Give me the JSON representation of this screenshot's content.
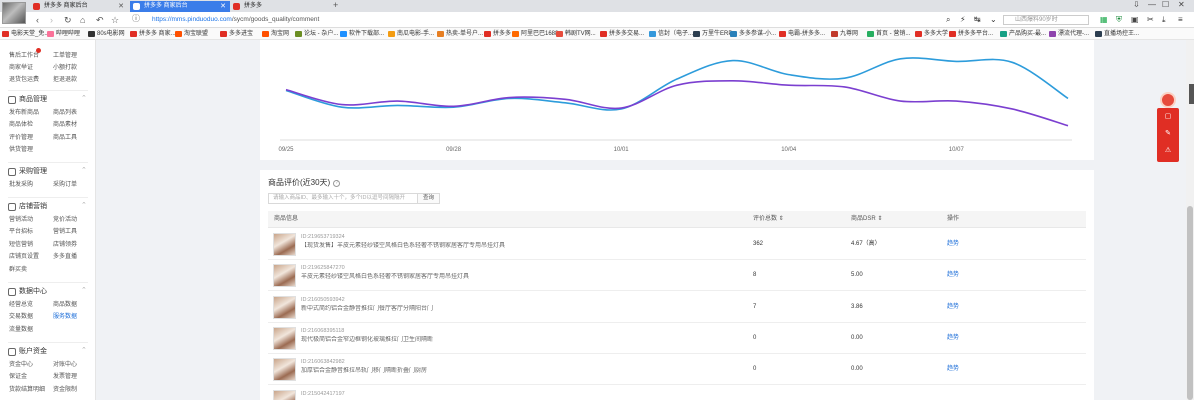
{
  "browser": {
    "tabs": [
      {
        "label": "拼多多 商家后台",
        "active": false
      },
      {
        "label": "拼多多 商家后台",
        "active": true
      },
      {
        "label": "拼多多",
        "active": false
      }
    ],
    "new_tab": "+",
    "url_host": "https://mms.pinduoduo.com",
    "url_path": "/sycm/goods_quality/comment",
    "search_placeholder": "山西爆料90岁时",
    "window_controls": [
      "⇩",
      "—",
      "☐",
      "✕"
    ]
  },
  "bookmarks": [
    "电影天堂_免...",
    "哔哩哔哩",
    "80s电影网",
    "拼多多 商家...",
    "淘宝联盟",
    "多多进宝",
    "淘宝网",
    "论坛 - 杂户...",
    "软件下载部...",
    "南瓜电影-手...",
    "热卖-单号户...",
    "拼多多",
    "阿里巴巴1688...",
    "韩剧TV网...",
    "拼多多交易...",
    "信封（电子...",
    "万里牛ERP",
    "多多参谋-小...",
    "电霸-拼多多...",
    "九尊网",
    "首页 - 营销...",
    "多多大学",
    "拼多多平台...",
    "产品购买-最...",
    "漂流代理-...",
    "直播场控王..."
  ],
  "sidebar": {
    "top_items": [
      {
        "label": "售后工作台",
        "col": 0
      },
      {
        "label": "工单管理",
        "col": 1
      },
      {
        "label": "商家举证",
        "col": 0
      },
      {
        "label": "小额打款",
        "col": 1
      },
      {
        "label": "退货包运费",
        "col": 0
      },
      {
        "label": "拒退退款",
        "col": 1
      }
    ],
    "sections": [
      {
        "title": "商品管理",
        "items": [
          "发布新商品",
          "商品列表",
          "商品体检",
          "商品素材",
          "评价管理",
          "商品工具",
          "供货管理"
        ]
      },
      {
        "title": "采购管理",
        "items": [
          "批发采购",
          "采购订单"
        ]
      },
      {
        "title": "店铺营销",
        "items": [
          "营销活动",
          "竞价活动",
          "平台招标",
          "营销工具",
          "短信营销",
          "店铺领券",
          "店铺页设置",
          "多多直播",
          "群买卖"
        ]
      },
      {
        "title": "数据中心",
        "items": [
          "经营总览",
          "商品数据",
          "交易数据",
          "服务数据",
          "流量数据"
        ]
      },
      {
        "title": "账户资金",
        "items": [
          "资金中心",
          "对账中心",
          "保证金",
          "发票管理",
          "货款结算明细",
          "资金限制"
        ]
      }
    ]
  },
  "chart_data": {
    "type": "line",
    "x": [
      "09/25",
      "09/26",
      "09/27",
      "09/28",
      "09/29",
      "09/30",
      "10/01",
      "10/02",
      "10/03",
      "10/04",
      "10/05",
      "10/06",
      "10/07",
      "10/08",
      "10/09"
    ],
    "tick_labels": [
      "09/25",
      "09/28",
      "10/01",
      "10/04",
      "10/07"
    ],
    "series": [
      {
        "color": "#2d9cdb",
        "values": [
          54,
          35,
          37,
          35,
          45,
          40,
          33,
          67,
          88,
          72,
          68,
          90,
          87,
          86,
          45
        ]
      },
      {
        "color": "#7b3fd0",
        "values": [
          55,
          38,
          42,
          36,
          46,
          44,
          34,
          60,
          65,
          60,
          58,
          42,
          42,
          33,
          14
        ]
      }
    ],
    "ylim": [
      0,
      100
    ],
    "grid": false,
    "legend": "none"
  },
  "reviews": {
    "title": "商品评价(近30天)",
    "help_icon": "?",
    "search_placeholder": "请输入商品ID、最多输入十个，多个ID以逗号间隔隔开",
    "search_button": "查询",
    "columns": [
      "商品信息",
      "评价总数 ⇕",
      "商品DSR ⇕",
      "操作"
    ],
    "rows": [
      {
        "id": "ID:219653719324",
        "name": "【现货发售】羊皮元素轻纱镂空风格白色系轻奢不锈钢家居客厅专用吊挂灯具",
        "count": "362",
        "dsr": "4.67（高）",
        "action": "趋势"
      },
      {
        "id": "ID:219625847270",
        "name": "羊皮元素轻纱镂空风格白色系轻奢不锈钢家居客厅专用吊挂灯具",
        "count": "8",
        "dsr": "5.00",
        "action": "趋势"
      },
      {
        "id": "ID:216050593942",
        "name": "新中式简约铝合金静音推拉门餐厅客厅分隔阳台门",
        "count": "7",
        "dsr": "3.86",
        "action": "趋势"
      },
      {
        "id": "ID:216068395118",
        "name": "现代极简铝合金窄边框钢化玻璃推拉门卫生间隔断",
        "count": "0",
        "dsr": "0.00",
        "action": "趋势"
      },
      {
        "id": "ID:216063842982",
        "name": "加厚铝合金静音推拉吊轨门移门隔断折叠门厨房",
        "count": "0",
        "dsr": "0.00",
        "action": "趋势"
      },
      {
        "id": "ID:215042417197",
        "name": "",
        "count": "",
        "dsr": "",
        "action": ""
      }
    ]
  },
  "colors": {
    "brand": "#e02e24",
    "link": "#1e6fd9",
    "tab_active": "#3b7de9"
  }
}
